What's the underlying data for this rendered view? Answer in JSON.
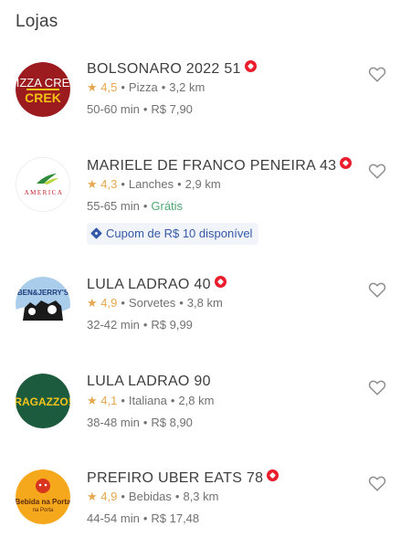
{
  "header": {
    "title": "Lojas"
  },
  "stores": [
    {
      "name": "BOLSONARO 2022 51",
      "rating": "4,5",
      "category": "Pizza",
      "distance": "3,2 km",
      "time": "50-60 min",
      "delivery": "R$ 7,90",
      "logo": "PIZZA CREK"
    },
    {
      "name": "MARIELE DE FRANCO PENEIRA 43",
      "rating": "4,3",
      "category": "Lanches",
      "distance": "2,9 km",
      "time": "55-65 min",
      "delivery": "Grátis",
      "coupon": "Cupom de R$ 10 disponível",
      "logo": "AMERICA"
    },
    {
      "name": "LULA LADRAO 40",
      "rating": "4,9",
      "category": "Sorvetes",
      "distance": "3,8 km",
      "time": "32-42 min",
      "delivery": "R$ 9,99",
      "logo": "BEN&JERRY'S"
    },
    {
      "name": "LULA LADRAO 90",
      "rating": "4,1",
      "category": "Italiana",
      "distance": "2,8 km",
      "time": "38-48 min",
      "delivery": "R$ 8,90",
      "logo": "RAGAZZO!"
    },
    {
      "name": "PREFIRO UBER EATS 78",
      "rating": "4,9",
      "category": "Bebidas",
      "distance": "8,3 km",
      "time": "44-54 min",
      "delivery": "R$ 17,48",
      "logo": "Bebida na Porta"
    }
  ],
  "colors": {
    "brand_red": "#ea1d2c",
    "star": "#e7a74e",
    "free": "#50a773",
    "coupon": "#3558a6"
  },
  "icons": {
    "favorite": "heart-outline-icon",
    "rating": "star-icon",
    "badge": "super-restaurant-badge-icon",
    "coupon": "tag-icon"
  }
}
